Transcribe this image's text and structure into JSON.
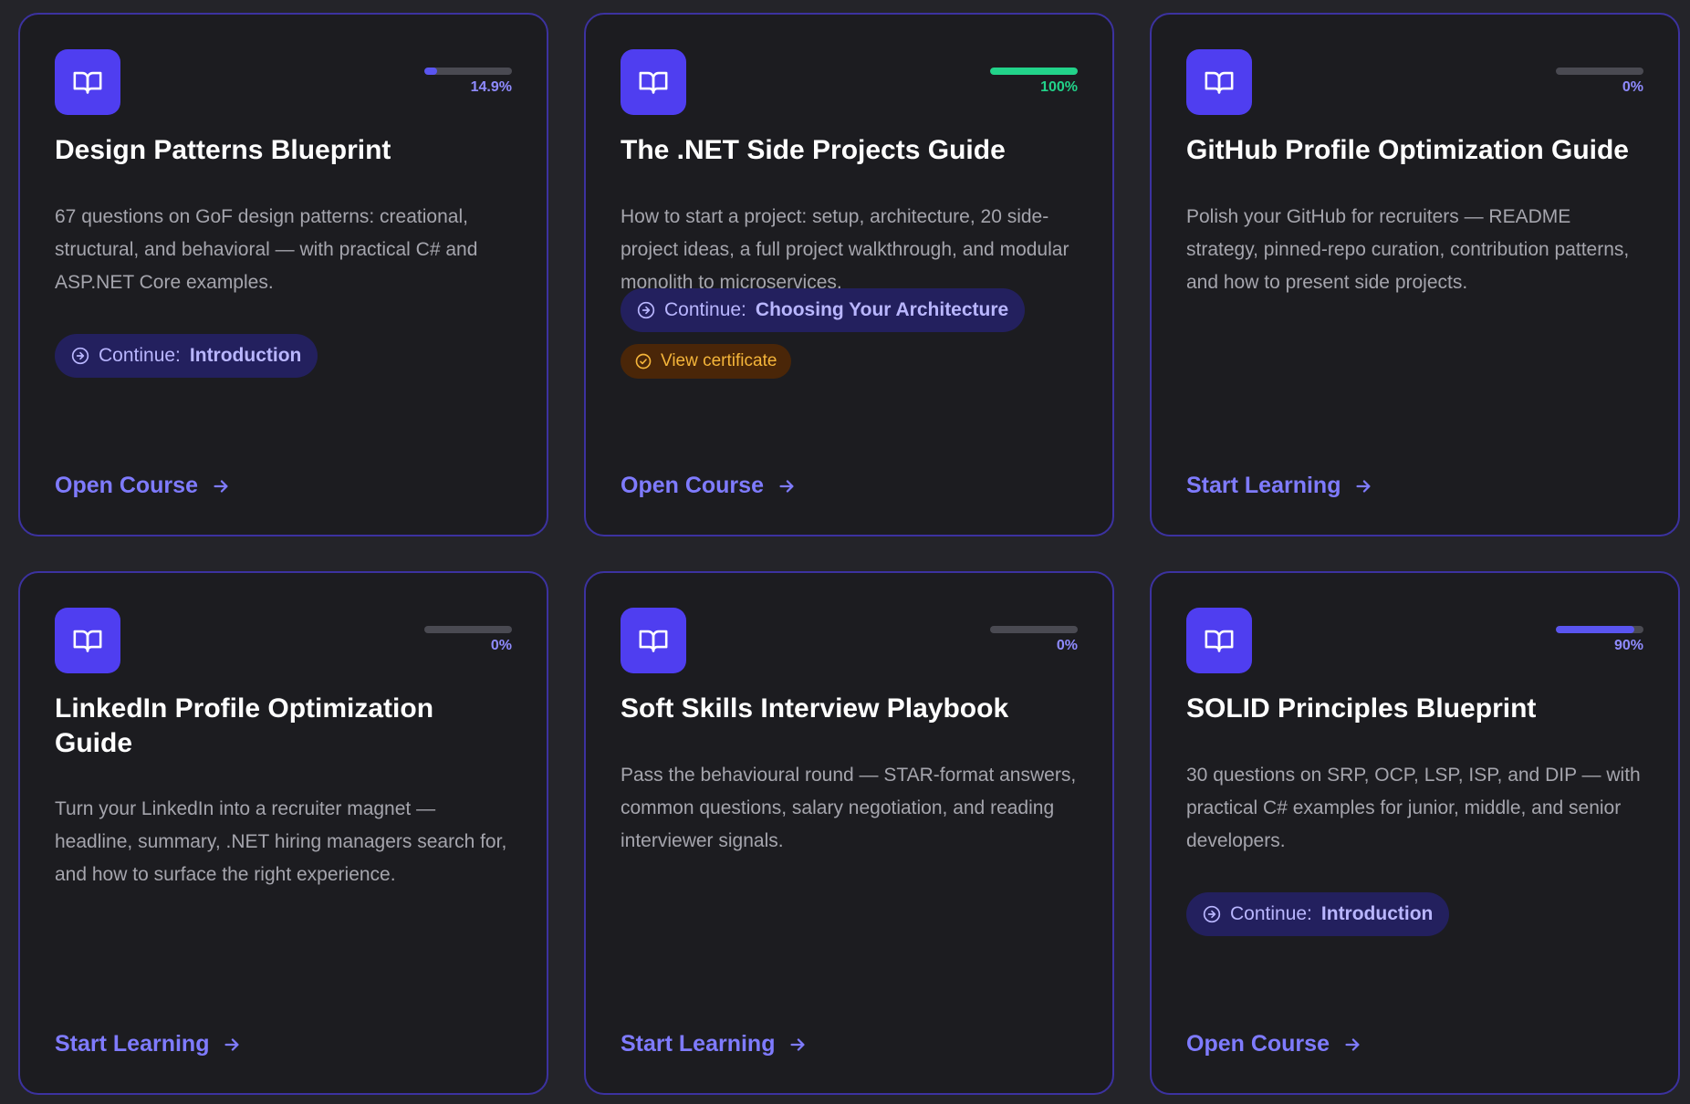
{
  "colors": {
    "background": "#242429",
    "card": "#1c1c20",
    "card_border": "#3c32a0",
    "icon_bg": "#4f3ef0",
    "accent": "#7f7bff",
    "progress_fill": "#5a55f0",
    "progress_done": "#22d38a",
    "certificate": "#f5b53a"
  },
  "cards": [
    {
      "icon": "book-icon",
      "title": "Design Patterns Blueprint",
      "description": "67 questions on GoF design patterns: creational, structural, and behavioral — with practical C# and ASP.NET Core examples.",
      "progress": {
        "value": 14.9,
        "label": "14.9%"
      },
      "continue": {
        "prefix": "Continue:",
        "lesson": "Introduction"
      },
      "cta": "Open Course"
    },
    {
      "icon": "book-icon",
      "title": "The .NET Side Projects Guide",
      "description": "How to start a project: setup, architecture, 20 side-project ideas, a full project walkthrough, and modular monolith to microservices.",
      "progress": {
        "value": 100,
        "label": "100%"
      },
      "continue": {
        "prefix": "Continue:",
        "lesson": "Choosing Your Architecture"
      },
      "certificate": "View certificate",
      "cta": "Open Course"
    },
    {
      "icon": "book-icon",
      "title": "GitHub Profile Optimization Guide",
      "description": "Polish your GitHub for recruiters — README strategy, pinned-repo curation, contribution patterns, and how to present side projects.",
      "progress": {
        "value": 0,
        "label": "0%"
      },
      "cta": "Start Learning"
    },
    {
      "icon": "book-icon",
      "title": "LinkedIn Profile Optimization Guide",
      "description": "Turn your LinkedIn into a recruiter magnet — headline, summary, .NET hiring managers search for, and how to surface the right experience.",
      "progress": {
        "value": 0,
        "label": "0%"
      },
      "cta": "Start Learning"
    },
    {
      "icon": "book-icon",
      "title": "Soft Skills Interview Playbook",
      "description": "Pass the behavioural round — STAR-format answers, common questions, salary negotiation, and reading interviewer signals.",
      "progress": {
        "value": 0,
        "label": "0%"
      },
      "cta": "Start Learning"
    },
    {
      "icon": "book-icon",
      "title": "SOLID Principles Blueprint",
      "description": "30 questions on SRP, OCP, LSP, ISP, and DIP — with practical C# examples for junior, middle, and senior developers.",
      "progress": {
        "value": 90,
        "label": "90%"
      },
      "continue": {
        "prefix": "Continue:",
        "lesson": "Introduction"
      },
      "cta": "Open Course"
    }
  ]
}
